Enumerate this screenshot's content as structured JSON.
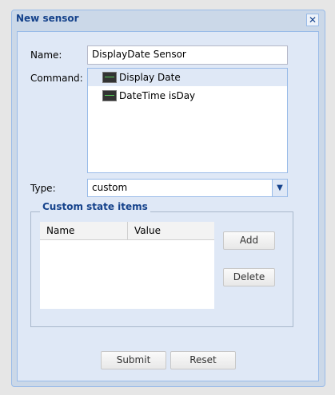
{
  "window": {
    "title": "New sensor",
    "close_icon": "close-icon"
  },
  "form": {
    "name_label": "Name:",
    "name_value": "DisplayDate Sensor",
    "command_label": "Command:",
    "commands": [
      {
        "label": "Display Date",
        "selected": true,
        "icon": "sensor-command-icon"
      },
      {
        "label": "DateTime isDay",
        "selected": false,
        "icon": "sensor-command-icon"
      }
    ],
    "type_label": "Type:",
    "type_value": "custom"
  },
  "custom_state": {
    "legend": "Custom state items",
    "columns": [
      "Name",
      "Value"
    ],
    "add_label": "Add",
    "delete_label": "Delete"
  },
  "footer": {
    "submit_label": "Submit",
    "reset_label": "Reset"
  }
}
